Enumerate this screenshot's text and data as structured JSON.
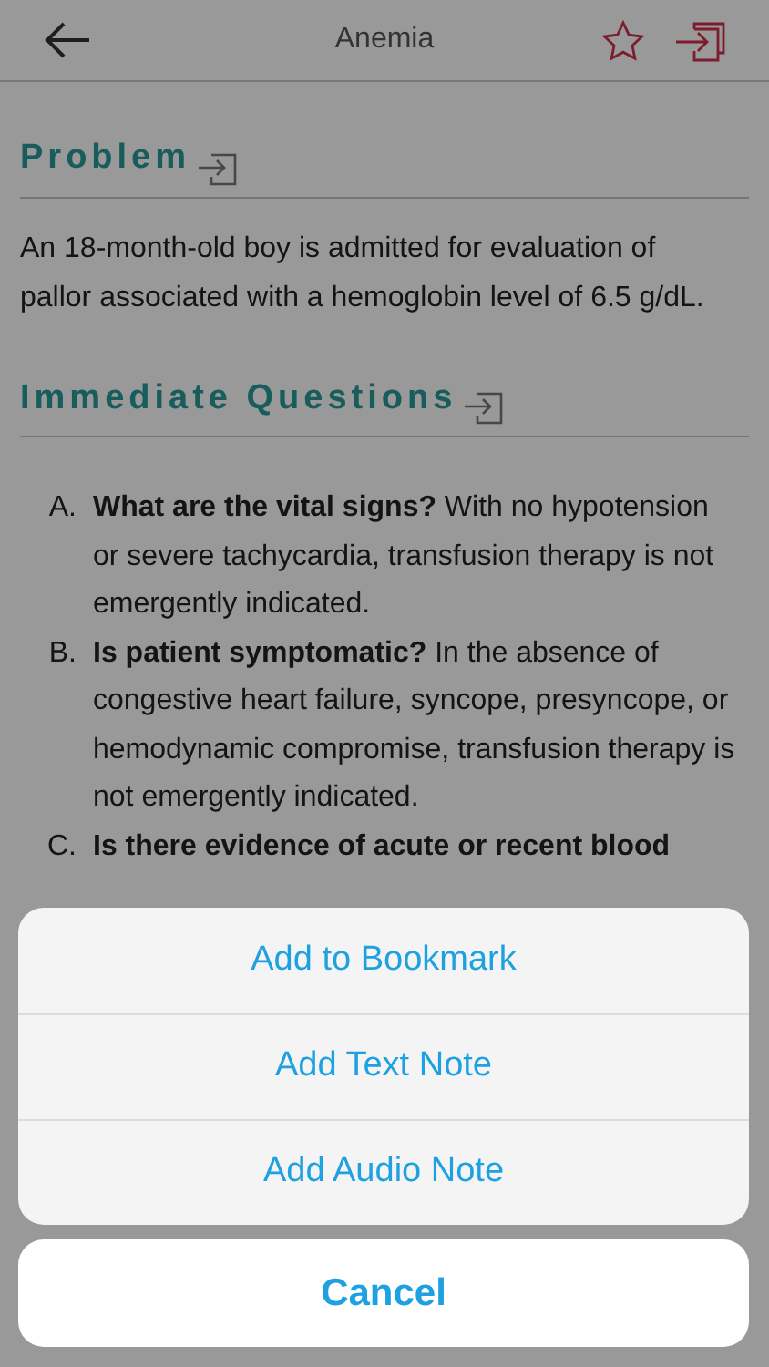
{
  "header": {
    "title": "Anemia"
  },
  "sections": [
    {
      "heading": "Problem",
      "paragraph": "An 18-month-old boy is admitted for evaluation of pallor associated with a hemoglobin level of 6.5 g/dL."
    },
    {
      "heading": "Immediate Questions",
      "items": [
        {
          "marker": "A.",
          "question": "What are the vital signs?",
          "text": "With no hypotension or severe tachycardia, transfusion therapy is not emergently indicated."
        },
        {
          "marker": "B.",
          "question": "Is patient symptomatic?",
          "text": "In the absence of congestive heart failure, syncope, presyncope, or hemodynamic compromise, transfusion therapy is not emergently indicated."
        },
        {
          "marker": "C.",
          "question": "Is there evidence of acute or recent blood"
        }
      ]
    }
  ],
  "action_sheet": {
    "actions": [
      "Add to Bookmark",
      "Add Text Note",
      "Add Audio Note"
    ],
    "cancel": "Cancel"
  }
}
